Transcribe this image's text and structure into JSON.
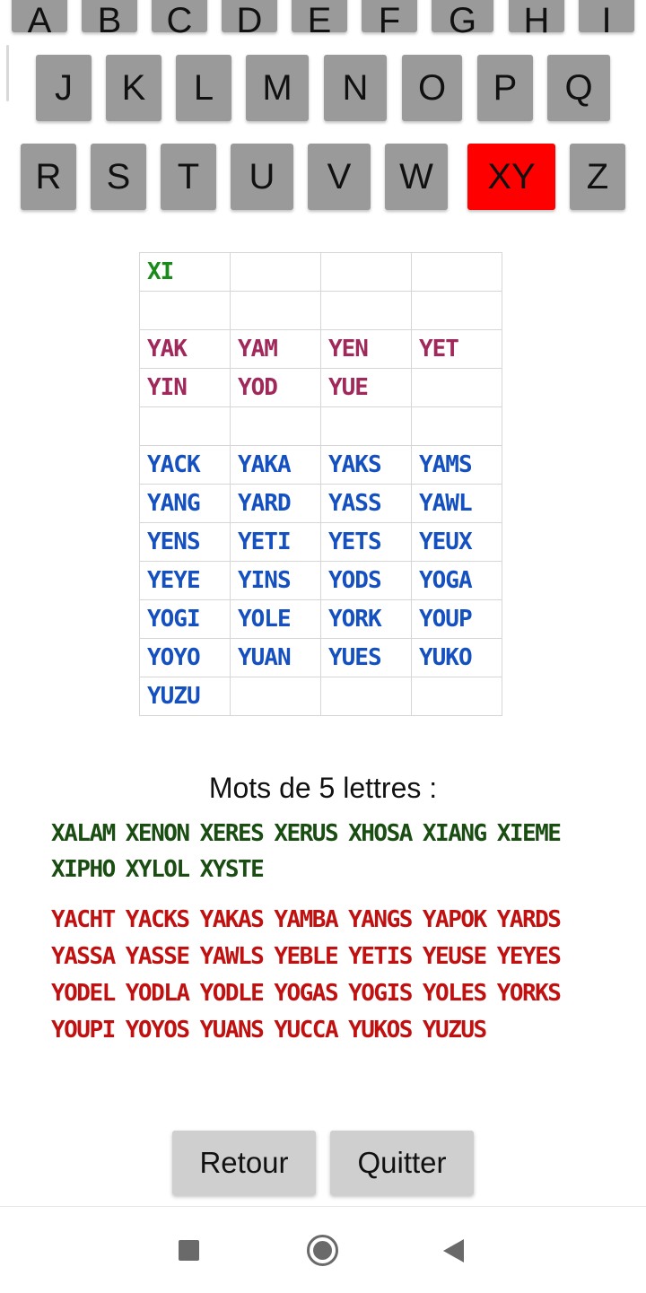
{
  "keyboard": {
    "row1": [
      "A",
      "B",
      "C",
      "D",
      "E",
      "F",
      "G",
      "H",
      "I"
    ],
    "row2": [
      "J",
      "K",
      "L",
      "M",
      "N",
      "O",
      "P",
      "Q"
    ],
    "row3": [
      "R",
      "S",
      "T",
      "U",
      "V",
      "W",
      "XY",
      "Z"
    ],
    "selected": "XY",
    "selected_color": "#ff0000",
    "key_color": "#9a9a9a"
  },
  "grid": {
    "rows": [
      [
        "XI",
        "",
        "",
        ""
      ],
      [
        "",
        "",
        "",
        ""
      ],
      [
        "YAK",
        "YAM",
        "YEN",
        "YET"
      ],
      [
        "YIN",
        "YOD",
        "YUE",
        ""
      ],
      [
        "",
        "",
        "",
        ""
      ],
      [
        "YACK",
        "YAKA",
        "YAKS",
        "YAMS"
      ],
      [
        "YANG",
        "YARD",
        "YASS",
        "YAWL"
      ],
      [
        "YENS",
        "YETI",
        "YETS",
        "YEUX"
      ],
      [
        "YEYE",
        "YINS",
        "YODS",
        "YOGA"
      ],
      [
        "YOGI",
        "YOLE",
        "YORK",
        "YOUP"
      ],
      [
        "YOYO",
        "YUAN",
        "YUES",
        "YUKO"
      ],
      [
        "YUZU",
        "",
        "",
        ""
      ]
    ],
    "colors": {
      "two_letters": "#1a8a1a",
      "three_letters": "#a0285a",
      "four_letters": "#1550c0"
    }
  },
  "five_letters": {
    "title": "Mots de 5 lettres :",
    "x_words": [
      "XALAM",
      "XENON",
      "XERES",
      "XERUS",
      "XHOSA",
      "XIANG",
      "XIEME",
      "XIPHO",
      "XYLOL",
      "XYSTE"
    ],
    "y_words": [
      "YACHT",
      "YACKS",
      "YAKAS",
      "YAMBA",
      "YANGS",
      "YAPOK",
      "YARDS",
      "YASSA",
      "YASSE",
      "YAWLS",
      "YEBLE",
      "YETIS",
      "YEUSE",
      "YEYES",
      "YODEL",
      "YODLA",
      "YODLE",
      "YOGAS",
      "YOGIS",
      "YOLES",
      "YORKS",
      "YOUPI",
      "YOYOS",
      "YUANS",
      "YUCCA",
      "YUKOS",
      "YUZUS"
    ],
    "x_color": "#1a4d12",
    "y_color": "#c01010"
  },
  "buttons": {
    "back": "Retour",
    "quit": "Quitter"
  },
  "navbar": {
    "recents": "square-icon",
    "home": "circle-icon",
    "back": "triangle-back-icon"
  }
}
